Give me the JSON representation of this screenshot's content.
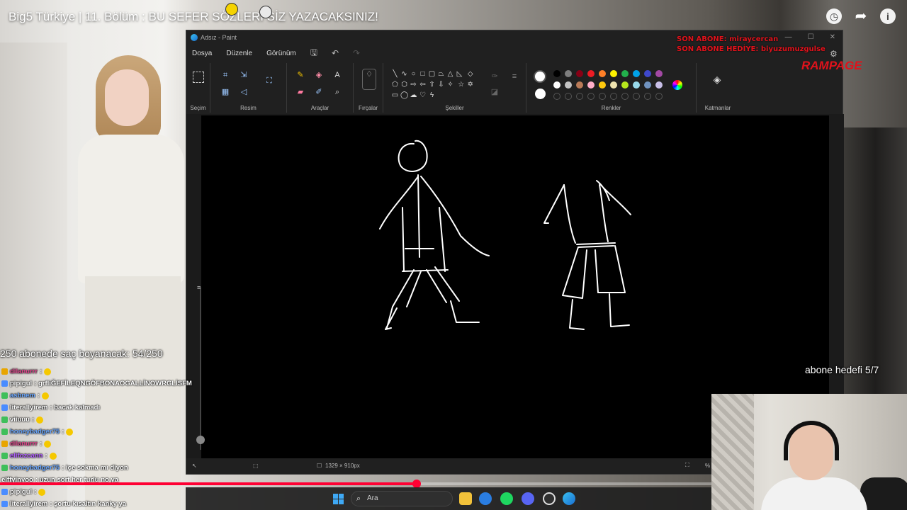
{
  "video": {
    "title": "Big5 Türkiye | 11. Bölüm : BU SEFER SÖZLERİ SİZ YAZACAKSINIZ!",
    "icons": [
      "clock-icon",
      "share-icon",
      "info-icon"
    ],
    "progress_fraction": 0.585
  },
  "paint": {
    "window_title": "Adsız - Paint",
    "menu": [
      "Dosya",
      "Düzenle",
      "Görünüm"
    ],
    "groups": {
      "selection": "Seçim",
      "image": "Resim",
      "tools": "Araçlar",
      "brushes": "Fırçalar",
      "shapes": "Şekiller",
      "colors": "Renkler",
      "layers": "Katmanlar"
    },
    "canvas_size": "1329 × 910px",
    "zoom_label": "%"
  },
  "overlay": {
    "abone_last": "SON ABONE: miraycercan",
    "abone_gift": "SON ABONE HEDİYE: biyuzumuzgulse",
    "brand": "RAMPAGE",
    "hair_goal": "250 abonede saç boyanacak: 54/250",
    "sub_goal": "abone hedefi 5/7"
  },
  "chat": [
    {
      "user": "dilanurrr",
      "msg": ":",
      "user_color": "#e0438b",
      "badge": "#e8a500",
      "emote": true
    },
    {
      "user": "pipigul",
      "msg": ": grfliĞEFİLEQNGÖFBONAOGALLİNOWRGLİSFM",
      "user_color": "#ffffff",
      "badge": "#4a8cff",
      "emote": false
    },
    {
      "user": "asbnem",
      "msg": ":",
      "user_color": "#6aa7ff",
      "badge": "#3fbf5a",
      "emote": true
    },
    {
      "user": "literallyirem",
      "msg": ": bacak kalmadı",
      "user_color": "#ffffff",
      "badge": "#4a8cff",
      "emote": false
    },
    {
      "user": "viiuuu",
      "msg": ":",
      "user_color": "#ffffff",
      "badge": "#3fbf5a",
      "emote": true
    },
    {
      "user": "honeybadger75",
      "msg": ":",
      "user_color": "#6aa7ff",
      "badge": "#3fbf5a",
      "emote": true
    },
    {
      "user": "dilanurrr",
      "msg": ":",
      "user_color": "#e0438b",
      "badge": "#e8a500",
      "emote": true
    },
    {
      "user": "elifozcann",
      "msg": ":",
      "user_color": "#b05cff",
      "badge": "#3fbf5a",
      "emote": true
    },
    {
      "user": "honeybadger75",
      "msg": ": içe sokma mı diyon",
      "user_color": "#6aa7ff",
      "badge": "#3fbf5a",
      "emote": false
    },
    {
      "user": "elffyinyoo",
      "msg": ": uzun sort her turlu no ya",
      "user_color": "#ffffff",
      "badge": "",
      "emote": false
    },
    {
      "user": "pipigul",
      "msg": ":",
      "user_color": "#ffffff",
      "badge": "#4a8cff",
      "emote": true
    },
    {
      "user": "literallyirem",
      "msg": ": şortu kısaltın kanky ya",
      "user_color": "#ffffff",
      "badge": "#4a8cff",
      "emote": false
    }
  ],
  "taskbar": {
    "search_placeholder": "Ara",
    "apps": [
      "file-explorer-icon",
      "edge-icon",
      "spotify-icon",
      "discord-icon",
      "obs-icon",
      "paint-icon"
    ]
  },
  "colors": {
    "accent_red": "#ff0033",
    "palette_row1": [
      "#000000",
      "#7f7f7f",
      "#880015",
      "#ed1c24",
      "#ff7f27",
      "#fff200",
      "#22b14c",
      "#00a2e8",
      "#3f48cc",
      "#a349a4"
    ],
    "palette_row2": [
      "#ffffff",
      "#c3c3c3",
      "#b97a57",
      "#ffaec9",
      "#ffc90e",
      "#efe4b0",
      "#b5e61d",
      "#99d9ea",
      "#7092be",
      "#c8bfe7"
    ]
  }
}
